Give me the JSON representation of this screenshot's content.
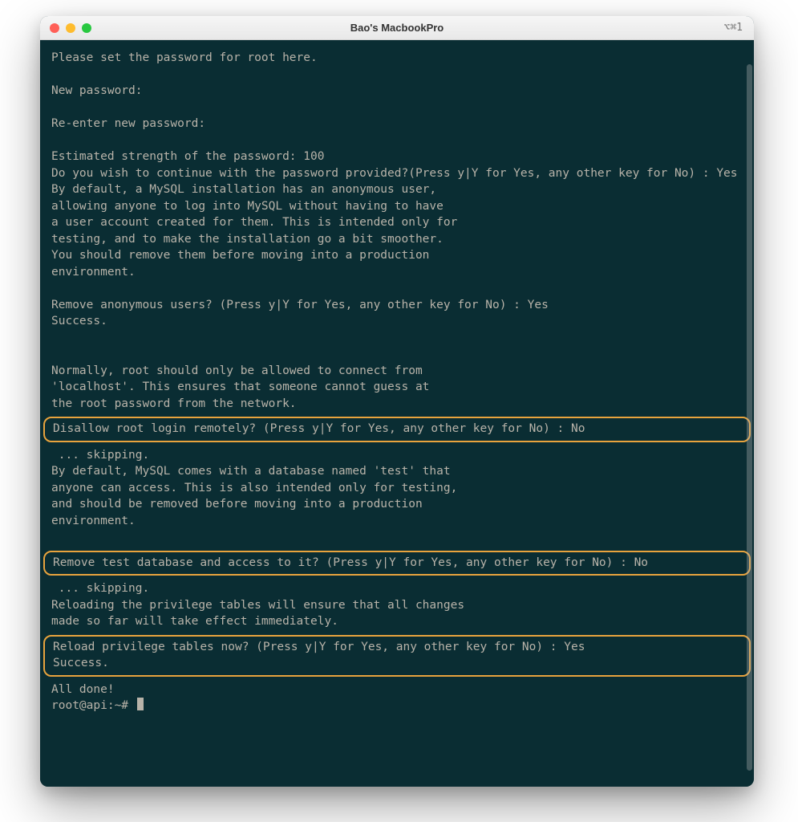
{
  "window": {
    "title": "Bao's MacbookPro",
    "shortcut": "⌥⌘1"
  },
  "terminal": {
    "blocks": [
      {
        "type": "plain",
        "lines": [
          "Please set the password for root here.",
          "",
          "New password:",
          "",
          "Re-enter new password:",
          "",
          "Estimated strength of the password: 100",
          "Do you wish to continue with the password provided?(Press y|Y for Yes, any other key for No) : Yes",
          "By default, a MySQL installation has an anonymous user,",
          "allowing anyone to log into MySQL without having to have",
          "a user account created for them. This is intended only for",
          "testing, and to make the installation go a bit smoother.",
          "You should remove them before moving into a production",
          "environment.",
          "",
          "Remove anonymous users? (Press y|Y for Yes, any other key for No) : Yes",
          "Success.",
          "",
          "",
          "Normally, root should only be allowed to connect from",
          "'localhost'. This ensures that someone cannot guess at",
          "the root password from the network."
        ]
      },
      {
        "type": "highlight",
        "lines": [
          "Disallow root login remotely? (Press y|Y for Yes, any other key for No) : No"
        ]
      },
      {
        "type": "plain",
        "lines": [
          " ... skipping.",
          "By default, MySQL comes with a database named 'test' that",
          "anyone can access. This is also intended only for testing,",
          "and should be removed before moving into a production",
          "environment.",
          ""
        ]
      },
      {
        "type": "highlight",
        "lines": [
          "Remove test database and access to it? (Press y|Y for Yes, any other key for No) : No"
        ]
      },
      {
        "type": "plain",
        "lines": [
          " ... skipping.",
          "Reloading the privilege tables will ensure that all changes",
          "made so far will take effect immediately."
        ]
      },
      {
        "type": "highlight",
        "lines": [
          "Reload privilege tables now? (Press y|Y for Yes, any other key for No) : Yes",
          "Success."
        ]
      },
      {
        "type": "plain",
        "lines": [
          "All done!"
        ]
      }
    ],
    "prompt": "root@api:~# "
  }
}
